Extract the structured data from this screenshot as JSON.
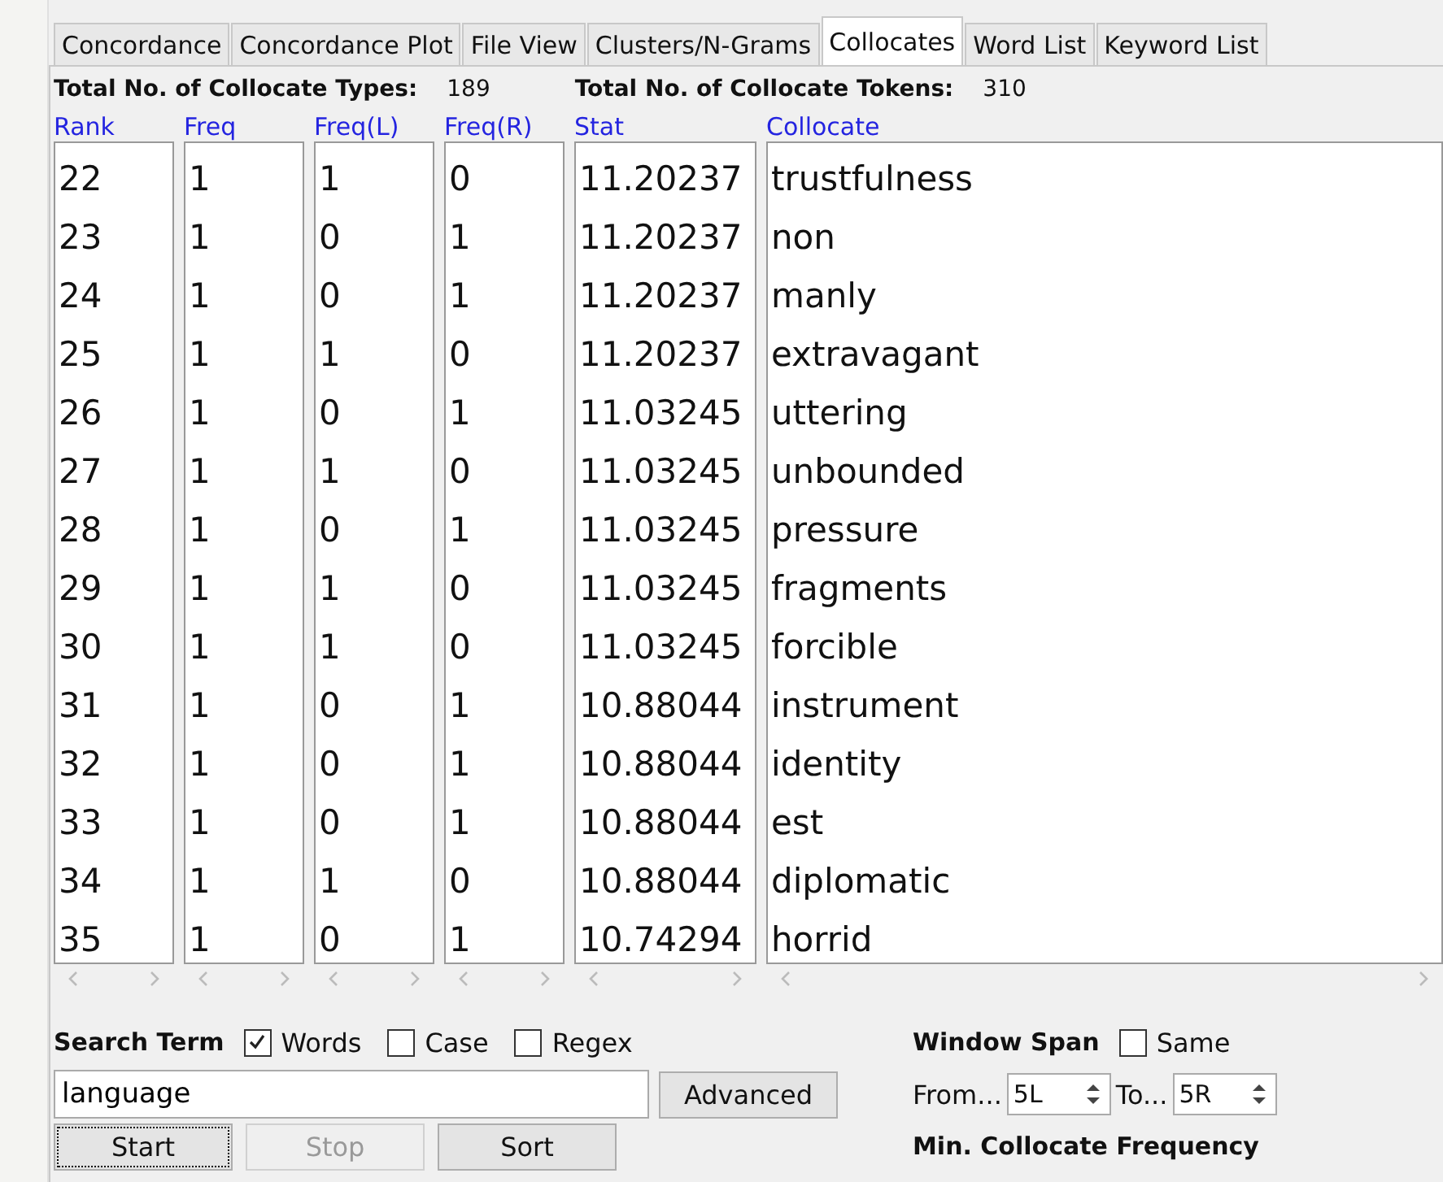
{
  "tabs": [
    {
      "label": "Concordance",
      "selected": false
    },
    {
      "label": "Concordance Plot",
      "selected": false
    },
    {
      "label": "File View",
      "selected": false
    },
    {
      "label": "Clusters/N-Grams",
      "selected": false
    },
    {
      "label": "Collocates",
      "selected": true
    },
    {
      "label": "Word List",
      "selected": false
    },
    {
      "label": "Keyword List",
      "selected": false
    }
  ],
  "totals": [
    {
      "label": "Total No. of Collocate Types:",
      "value": "189"
    },
    {
      "label": "Total No. of Collocate Tokens:",
      "value": "310"
    }
  ],
  "table": {
    "columns": [
      "Rank",
      "Freq",
      "Freq(L)",
      "Freq(R)",
      "Stat",
      "Collocate"
    ],
    "rows": [
      [
        "22",
        "1",
        "1",
        "0",
        "11.20237",
        "trustfulness"
      ],
      [
        "23",
        "1",
        "0",
        "1",
        "11.20237",
        "non"
      ],
      [
        "24",
        "1",
        "0",
        "1",
        "11.20237",
        "manly"
      ],
      [
        "25",
        "1",
        "1",
        "0",
        "11.20237",
        "extravagant"
      ],
      [
        "26",
        "1",
        "0",
        "1",
        "11.03245",
        "uttering"
      ],
      [
        "27",
        "1",
        "1",
        "0",
        "11.03245",
        "unbounded"
      ],
      [
        "28",
        "1",
        "0",
        "1",
        "11.03245",
        "pressure"
      ],
      [
        "29",
        "1",
        "1",
        "0",
        "11.03245",
        "fragments"
      ],
      [
        "30",
        "1",
        "1",
        "0",
        "11.03245",
        "forcible"
      ],
      [
        "31",
        "1",
        "0",
        "1",
        "10.88044",
        "instrument"
      ],
      [
        "32",
        "1",
        "0",
        "1",
        "10.88044",
        "identity"
      ],
      [
        "33",
        "1",
        "0",
        "1",
        "10.88044",
        "est"
      ],
      [
        "34",
        "1",
        "1",
        "0",
        "10.88044",
        "diplomatic"
      ],
      [
        "35",
        "1",
        "0",
        "1",
        "10.74294",
        "horrid"
      ]
    ]
  },
  "search": {
    "label": "Search Term",
    "options": [
      {
        "label": "Words",
        "checked": true
      },
      {
        "label": "Case",
        "checked": false
      },
      {
        "label": "Regex",
        "checked": false
      }
    ],
    "value": "language",
    "advanced": "Advanced"
  },
  "buttons": [
    {
      "label": "Start",
      "disabled": false,
      "focused": true
    },
    {
      "label": "Stop",
      "disabled": true,
      "focused": false
    },
    {
      "label": "Sort",
      "disabled": false,
      "focused": false
    }
  ],
  "window_span": {
    "label": "Window Span",
    "same": {
      "label": "Same",
      "checked": false
    },
    "from_label": "From...",
    "from": "5L",
    "to_label": "To...",
    "to": "5R"
  },
  "min_frequency_label": "Min. Collocate Frequency"
}
